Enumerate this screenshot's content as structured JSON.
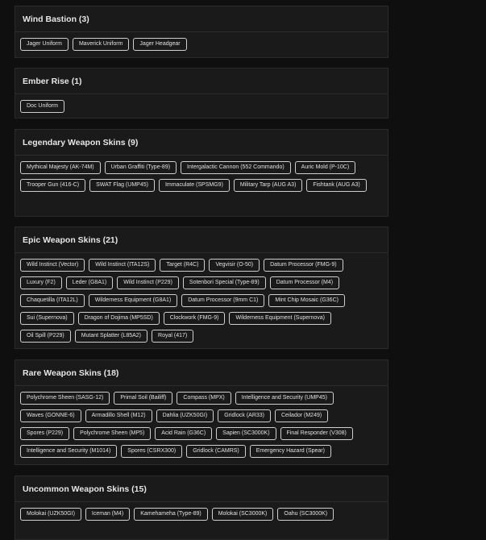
{
  "sections": [
    {
      "title": "Wind Bastion (3)",
      "items": [
        "Jager Uniform",
        "Maverick Uniform",
        "Jager Headgear"
      ]
    },
    {
      "title": "Ember Rise (1)",
      "items": [
        "Doc Uniform"
      ]
    },
    {
      "title": "Legendary Weapon Skins (9)",
      "items": [
        "Mythical Majesty (AK-74M)",
        "Urban Graffiti (Type-89)",
        "Intergalactic Cannon (552 Commando)",
        "Auric Mold (P-10C)",
        "Trooper Gun (416-C)",
        "SWAT Flag (UMP45)",
        "Immaculate (SPSMG9)",
        "Military Tarp (AUG A3)",
        "Fishtank (AUG A3)"
      ]
    },
    {
      "title": "Epic Weapon Skins (21)",
      "items": [
        "Wild Instinct (Vector)",
        "Wild Instinct (ITA12S)",
        "Target (R4C)",
        "Vegvisir (O-50)",
        "Datum Processor (FMG-9)",
        "Luxury (F2)",
        "Leder (G8A1)",
        "Wild Instinct (P229)",
        "Sotenbori Special (Type-89)",
        "Datum Processor (M4)",
        "Chaquetilla (ITA12L)",
        "Wilderness Equipment (G8A1)",
        "Datum Processor (9mm C1)",
        "Mint Chip Mosaic (G36C)",
        "Sui (Supernova)",
        "Dragon of Dojima (MP5SD)",
        "Clockwork (FMG-9)",
        "Wilderness Equipment (Supernova)",
        "Oil Spill (P229)",
        "Mutant Splatter (L85A2)",
        "Royal (417)"
      ]
    },
    {
      "title": "Rare Weapon Skins (18)",
      "items": [
        "Polychrome Sheen (SASG-12)",
        "Primal Soil (Bailiff)",
        "Compass (MPX)",
        "Intelligence and Security (UMP45)",
        "Waves (GONNE-6)",
        "Armadillo Shell (M12)",
        "Dahlia (UZK50GI)",
        "Gridlock (AR33)",
        "Ceilador (M249)",
        "Spores (P229)",
        "Polychrome Sheen (MP5)",
        "Acid Rain (G36C)",
        "Sapien (SC3000K)",
        "Final Responder (V308)",
        "Intelligence and Security (M1014)",
        "Spores (CSRX300)",
        "Gridlock (CAMRS)",
        "Emergency Hazard (Spear)"
      ]
    },
    {
      "title": "Uncommon Weapon Skins (15)",
      "items": [
        "Molokai (UZK50GI)",
        "Iceman (M4)",
        "Kamehameha (Type-89)",
        "Molokai (SC3000K)",
        "Oahu (SC3000K)"
      ]
    }
  ]
}
